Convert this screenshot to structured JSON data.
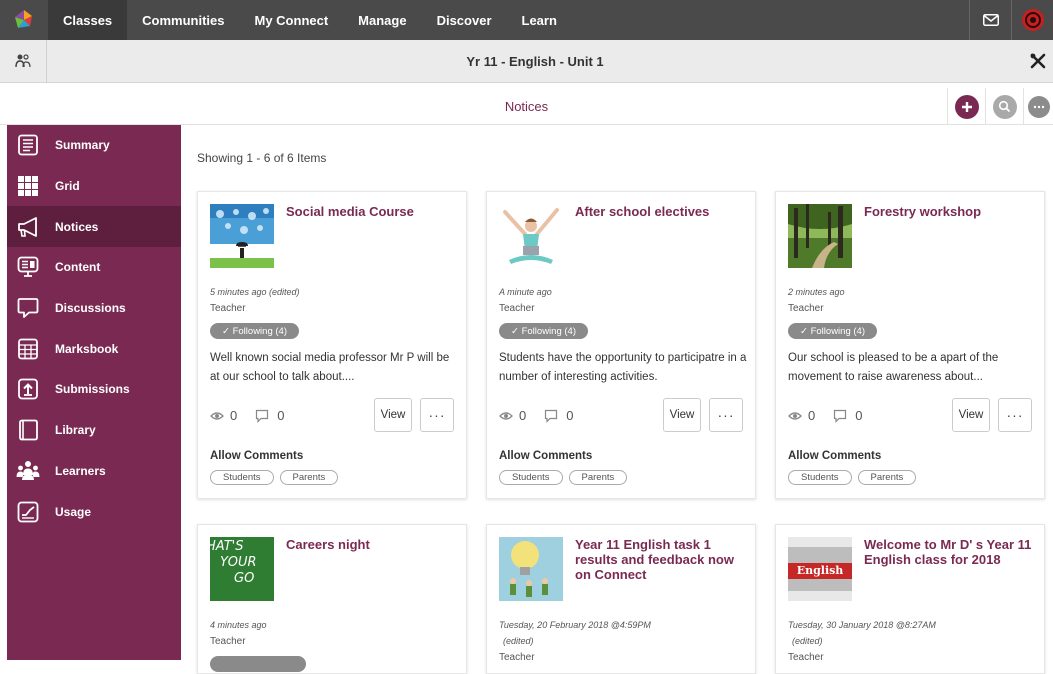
{
  "topnav": {
    "items": [
      "Classes",
      "Communities",
      "My Connect",
      "Manage",
      "Discover",
      "Learn"
    ],
    "active": "Classes"
  },
  "titlebar": {
    "title": "Yr 11 - English - Unit 1"
  },
  "section": {
    "title": "Notices"
  },
  "sidebar": {
    "items": [
      {
        "label": "Summary",
        "icon": "summary-icon"
      },
      {
        "label": "Grid",
        "icon": "grid-icon"
      },
      {
        "label": "Notices",
        "icon": "megaphone-icon"
      },
      {
        "label": "Content",
        "icon": "content-icon"
      },
      {
        "label": "Discussions",
        "icon": "discussions-icon"
      },
      {
        "label": "Marksbook",
        "icon": "marksbook-icon"
      },
      {
        "label": "Submissions",
        "icon": "submissions-icon"
      },
      {
        "label": "Library",
        "icon": "library-icon"
      },
      {
        "label": "Learners",
        "icon": "learners-icon"
      },
      {
        "label": "Usage",
        "icon": "usage-icon"
      }
    ],
    "active": "Notices"
  },
  "main": {
    "showing": "Showing 1 - 6 of 6 Items",
    "view_label": "View",
    "more_label": "···",
    "allow_comments": "Allow Comments",
    "tags": [
      "Students",
      "Parents"
    ],
    "cards": [
      {
        "title": "Social media Course",
        "time": "5 minutes ago (edited)",
        "role": "Teacher",
        "following": "✓ Following (4)",
        "desc": "Well known social media professor Mr P will be at our school to talk about....",
        "views": "0",
        "comments": "0"
      },
      {
        "title": "After school electives",
        "time": "A minute ago",
        "role": "Teacher",
        "following": "✓ Following (4)",
        "desc": "Students have the opportunity to participatre in a number of interesting activities.",
        "views": "0",
        "comments": "0"
      },
      {
        "title": "Forestry workshop",
        "time": "2 minutes ago",
        "role": "Teacher",
        "following": "✓ Following (4)",
        "desc": "Our school is pleased to be a apart of the movement to raise awareness about...",
        "views": "0",
        "comments": "0"
      },
      {
        "title": "Careers night",
        "time": "4 minutes ago",
        "role": "Teacher",
        "thumb_text": [
          "HAT'S",
          "YOUR",
          "GO"
        ]
      },
      {
        "title": "Year 11 English task 1 results and feedback now on Connect",
        "time": "Tuesday, 20 February 2018 @4:59PM",
        "edited": "(edited)",
        "role": "Teacher"
      },
      {
        "title": "Welcome to Mr D' s Year 11 English class for 2018",
        "time": "Tuesday, 30 January 2018 @8:27AM",
        "edited": "(edited)",
        "role": "Teacher",
        "thumb_text": "English"
      }
    ]
  },
  "colors": {
    "brand": "#7a2a52",
    "topbar": "#4a4a4a",
    "sidebar_active": "#5e1e3e"
  }
}
